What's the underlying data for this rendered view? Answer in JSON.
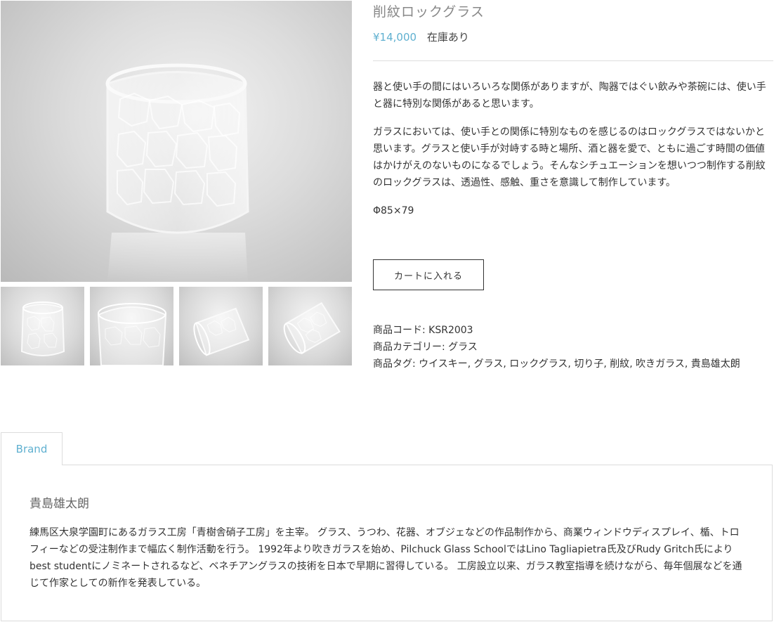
{
  "product": {
    "title": "削紋ロックグラス",
    "price": "¥14,000",
    "stock": "在庫あり",
    "description": [
      "器と使い手の間にはいろいろな関係がありますが、陶器ではぐい飲みや茶碗には、使い手と器に特別な関係があると思います。",
      "ガラスにおいては、使い手との関係に特別なものを感じるのはロックグラスではないかと思います。グラスと使い手が対峙する時と場所、酒と器を愛で、ともに過ごす時間の価値はかけがえのないものになるでしょう。そんなシチュエーションを想いつつ制作する削紋のロックグラスは、透過性、感触、重さを意識して制作しています。"
    ],
    "size": "Φ85×79",
    "cart_button": "カートに入れる",
    "meta": {
      "code": "商品コード: KSR2003",
      "category": "商品カテゴリー: グラス",
      "tags": "商品タグ: ウイスキー, グラス, ロックグラス, 切り子, 削紋, 吹きガラス, 貴島雄太朗"
    }
  },
  "tabs": {
    "brand_label": "Brand"
  },
  "brand": {
    "name": "貴島雄太朗",
    "bio": "練馬区大泉学園町にあるガラス工房「青樹舎硝子工房」を主宰。 グラス、うつわ、花器、オブジェなどの作品制作から、商業ウィンドウディスプレイ、楯、トロフィーなどの受注制作まで幅広く制作活動を行う。 1992年より吹きガラスを始め、Pilchuck Glass SchoolではLino Tagliapietra氏及びRudy Gritch氏によりbest studentにノミネートされるなど、ベネチアングラスの技術を日本で早期に習得している。 工房設立以来、ガラス教室指導を続けながら、毎年個展などを通じて作家としての新作を発表している。"
  },
  "colors": {
    "accent": "#5fb0d0",
    "border": "#dcdcdc"
  }
}
